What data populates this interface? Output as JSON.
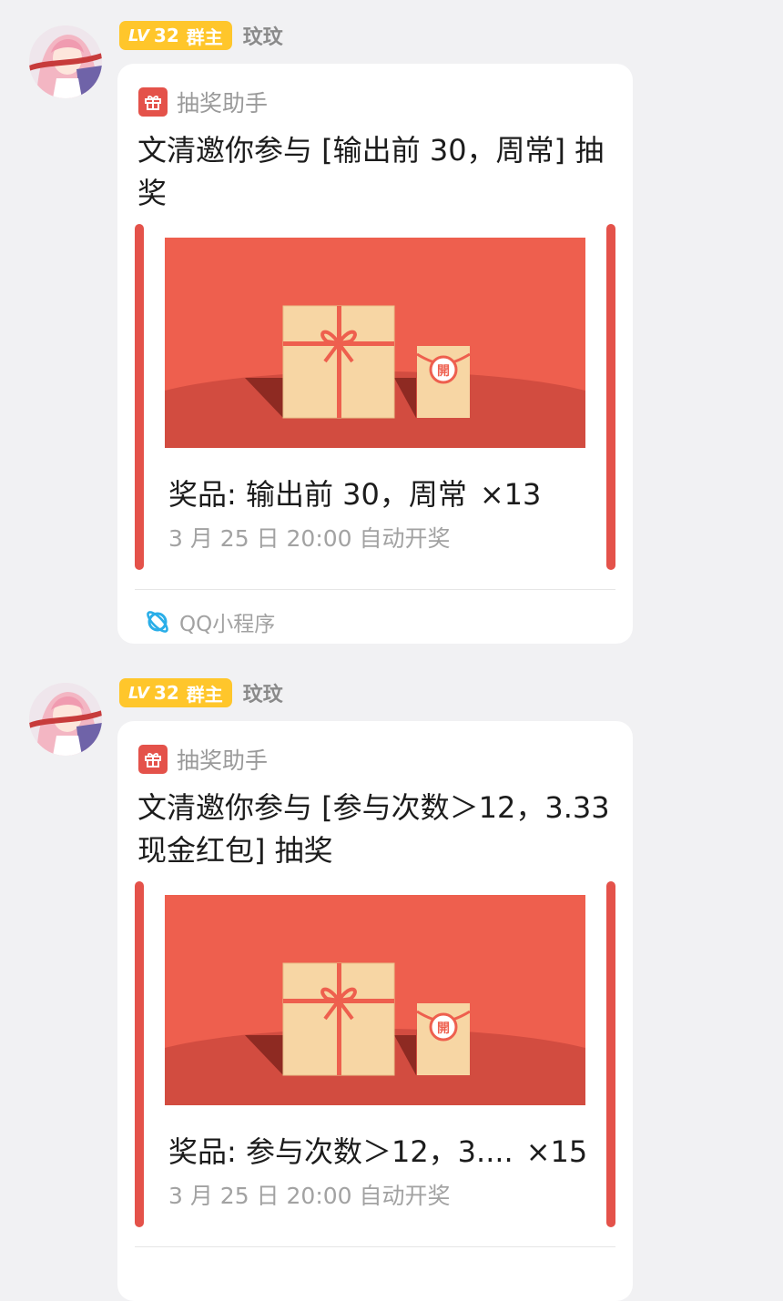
{
  "messages": [
    {
      "sender": {
        "level_prefix": "LV",
        "level": "32",
        "role": "群主",
        "name": "玟玟"
      },
      "card": {
        "header_label": "抽奖助手",
        "title": "文清邀你参与 [输出前 30，周常] 抽奖",
        "prize_label": "奖品: 输出前 30，周常",
        "prize_count": "×13",
        "draw_time": "3 月 25 日 20:00 自动开奖",
        "footer_label": "QQ小程序",
        "badge_char": "開"
      }
    },
    {
      "sender": {
        "level_prefix": "LV",
        "level": "32",
        "role": "群主",
        "name": "玟玟"
      },
      "card": {
        "header_label": "抽奖助手",
        "title": "文清邀你参与 [参与次数＞12，3.33 现金红包] 抽奖",
        "prize_label": "奖品: 参与次数＞12，3....",
        "prize_count": "×15",
        "draw_time": "3 月 25 日 20:00 自动开奖",
        "badge_char": "開"
      }
    }
  ],
  "colors": {
    "background": "#f1f1f3",
    "accent_red": "#e4524a",
    "banner_red": "#ee5f4e",
    "box_tan": "#f7d6a4",
    "level_badge": "#ffc62b",
    "mini_program_icon": "#2aaee8"
  },
  "icons": [
    "avatar",
    "gift-icon",
    "gift-box-icon",
    "red-envelope-icon",
    "mini-program-icon"
  ]
}
